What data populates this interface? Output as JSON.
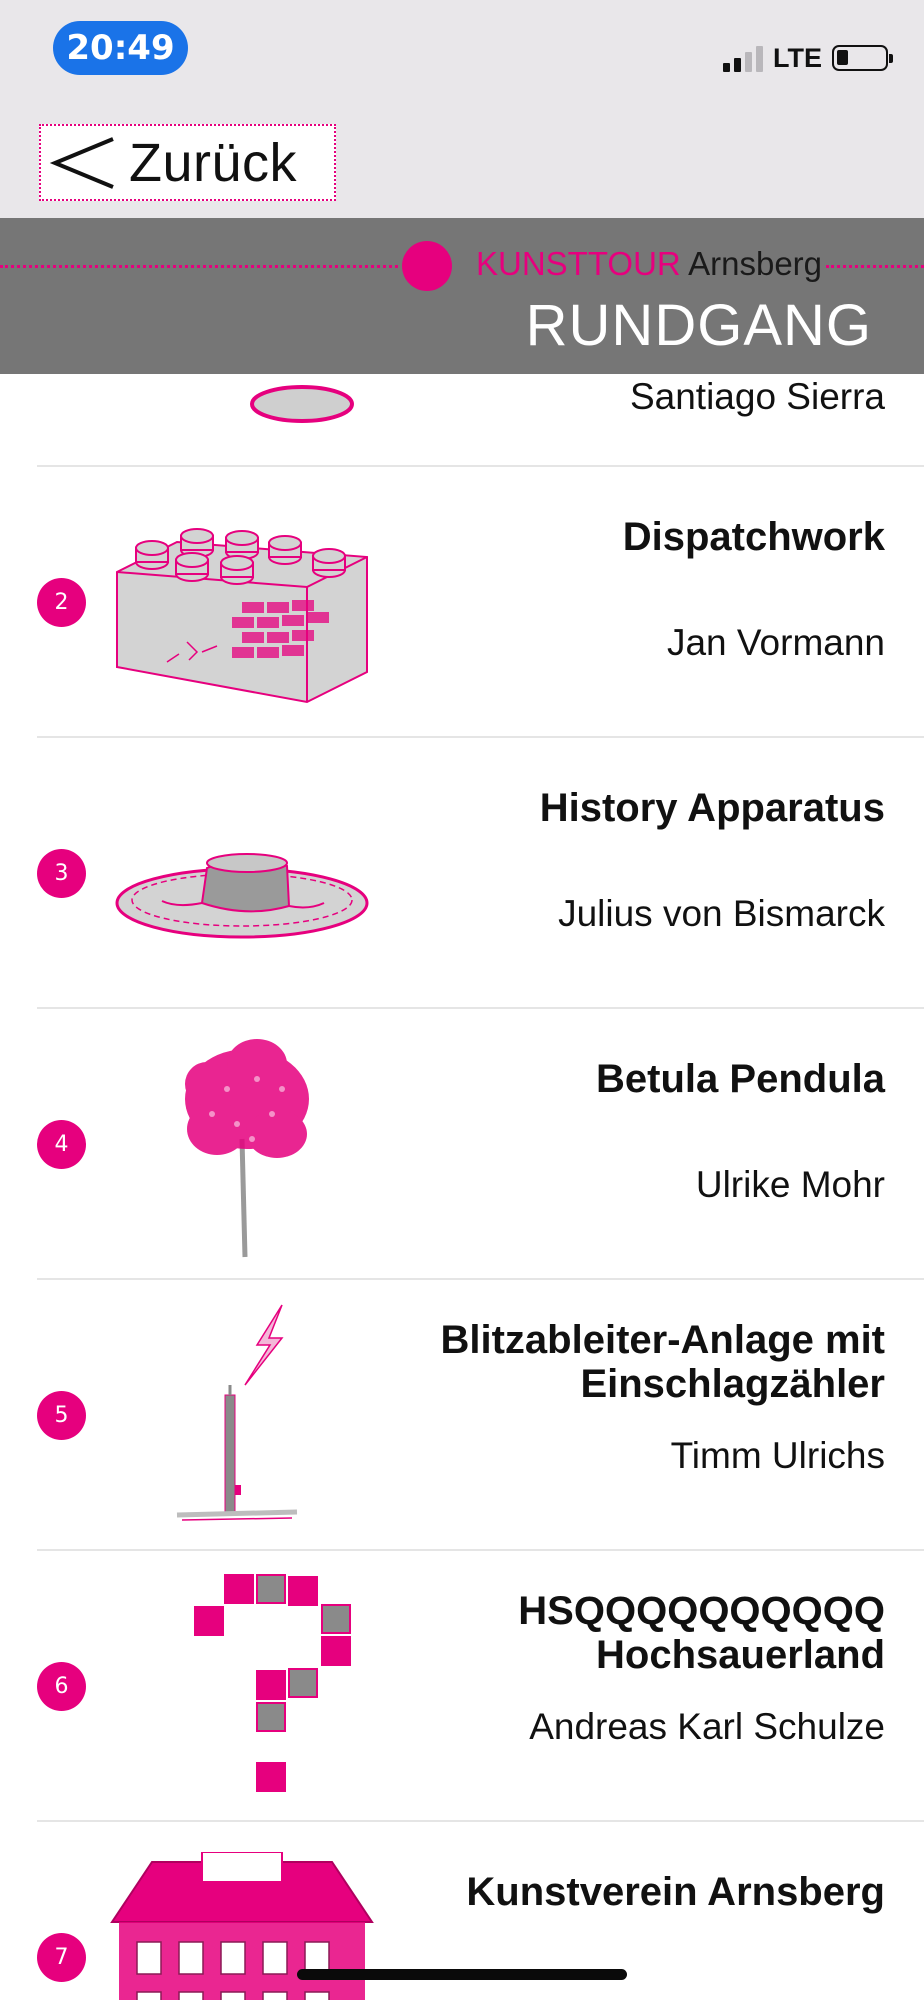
{
  "status_bar": {
    "time": "20:49",
    "network": "LTE"
  },
  "nav": {
    "back_label": "Zurück"
  },
  "header": {
    "brand_accent": "KUNSTTOUR",
    "brand_city": "Arnsberg",
    "title": "RUNDGANG"
  },
  "colors": {
    "accent": "#e6007e",
    "band": "#767676",
    "status_bg": "#e9e7ea",
    "time_pill": "#1a73e8"
  },
  "items": [
    {
      "number": "",
      "title": "",
      "artist": "Santiago Sierra",
      "icon": "oval-plate-icon"
    },
    {
      "number": "2",
      "title": "Dispatchwork",
      "artist": "Jan Vormann",
      "icon": "lego-brick-icon"
    },
    {
      "number": "3",
      "title": "History Apparatus",
      "artist": "Julius von Bismarck",
      "icon": "tree-stump-icon"
    },
    {
      "number": "4",
      "title": "Betula Pendula",
      "artist": "Ulrike Mohr",
      "icon": "birch-tree-icon"
    },
    {
      "number": "5",
      "title": "Blitzableiter-Anlage mit Einschlagzähler",
      "artist": "Timm Ulrichs",
      "icon": "lightning-rod-icon"
    },
    {
      "number": "6",
      "title": "HSQQQQQQQQQQ Hochsauerland",
      "artist": "Andreas Karl Schulze",
      "icon": "question-mark-tiles-icon"
    },
    {
      "number": "7",
      "title": "Kunstverein Arnsberg",
      "artist": "",
      "icon": "building-icon"
    }
  ]
}
